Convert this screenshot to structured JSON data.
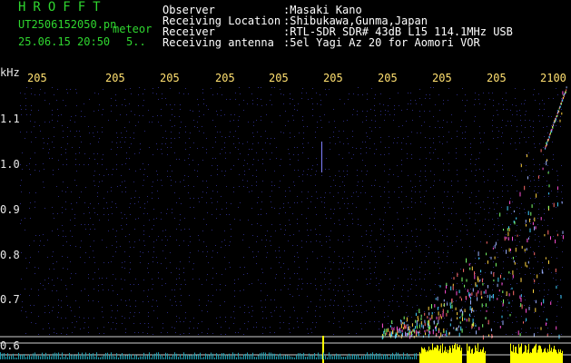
{
  "header": {
    "app_title": "HROFFT",
    "filename": "UT2506152050.pn",
    "meteor_tag": "meteor",
    "datetime": "25.06.15 20:50",
    "small_value": "5.."
  },
  "info": {
    "observer_label": "Observer",
    "observer_value": ":Masaki Kano",
    "location_label": "Receiving Location",
    "location_value": ":Shibukawa,Gunma,Japan",
    "receiver_label": "Receiver",
    "receiver_value": ":RTL-SDR SDR# 43dB L15 114.1MHz USB",
    "antenna_label": "Receiving antenna",
    "antenna_value": ":5el Yagi Az 20 for Aomori VOR"
  },
  "axis": {
    "y_unit": "kHz",
    "top_ticks": [
      "205",
      "205",
      "205",
      "205",
      "205",
      "205",
      "205",
      "205",
      "205",
      "2100"
    ],
    "y_ticks": [
      "1.1",
      "1.0",
      "0.9",
      "0.8",
      "0.7",
      "0.6"
    ]
  },
  "colors": {
    "background": "#000000",
    "title_green": "#2fd62f",
    "signal_yellow": "#ffff00",
    "grid_dot_blue": "#2a2a80"
  }
}
